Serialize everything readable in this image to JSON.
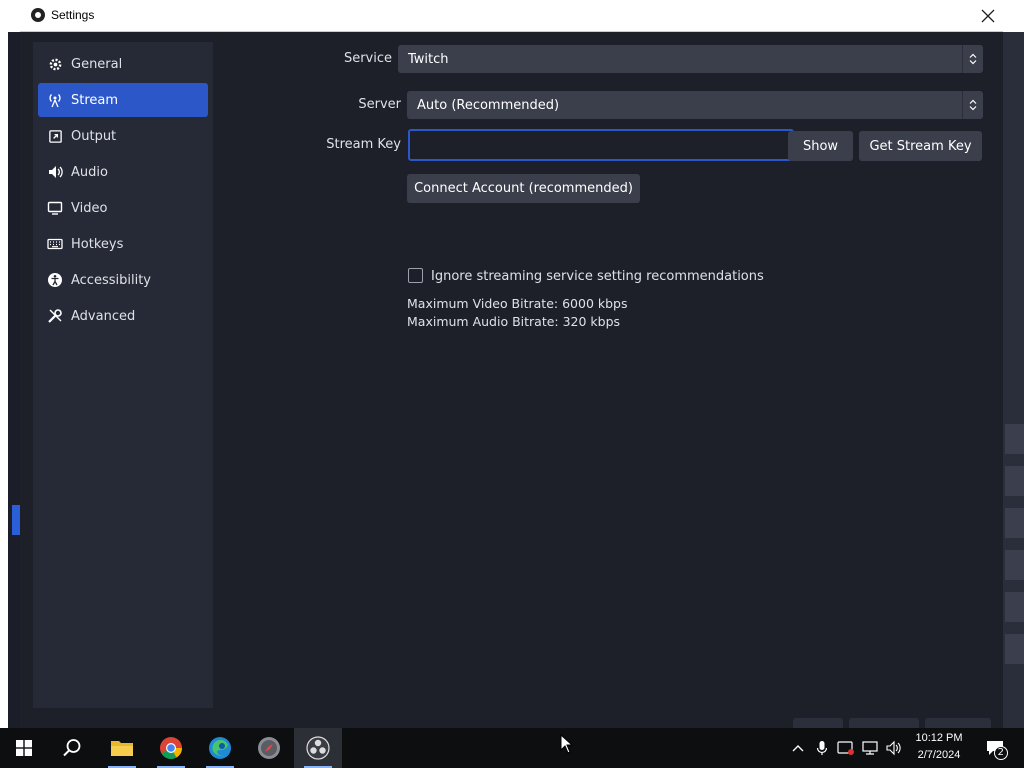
{
  "window": {
    "title": "Settings",
    "close_glyph": "✕",
    "icon": "obs-icon"
  },
  "sidebar": {
    "items": [
      {
        "label": "General",
        "icon": "gear-icon"
      },
      {
        "label": "Stream",
        "icon": "antenna-icon",
        "active": true
      },
      {
        "label": "Output",
        "icon": "output-icon"
      },
      {
        "label": "Audio",
        "icon": "speaker-icon"
      },
      {
        "label": "Video",
        "icon": "monitor-icon"
      },
      {
        "label": "Hotkeys",
        "icon": "keyboard-icon"
      },
      {
        "label": "Accessibility",
        "icon": "accessibility-icon"
      },
      {
        "label": "Advanced",
        "icon": "wrench-icon"
      }
    ]
  },
  "stream": {
    "service_label": "Service",
    "service_value": "Twitch",
    "server_label": "Server",
    "server_value": "Auto (Recommended)",
    "stream_key_label": "Stream Key",
    "stream_key_value": "",
    "show_button": "Show",
    "get_key_button": "Get Stream Key",
    "connect_button": "Connect Account (recommended)",
    "ignore_checkbox_label": "Ignore streaming service setting recommendations",
    "ignore_checked": false,
    "max_video_bitrate": "Maximum Video Bitrate: 6000 kbps",
    "max_audio_bitrate": "Maximum Audio Bitrate: 320 kbps"
  },
  "taskbar": {
    "apps": [
      "start-icon",
      "search-icon",
      "file-explorer-icon",
      "chrome-icon",
      "edge-icon",
      "app-compass-icon",
      "obs-taskbar-icon"
    ],
    "time": "10:12 PM",
    "date": "2/7/2024",
    "notification_count": "2"
  },
  "colors": {
    "accent": "#2c57c9",
    "panel": "#262a36",
    "background": "#1d2029"
  }
}
